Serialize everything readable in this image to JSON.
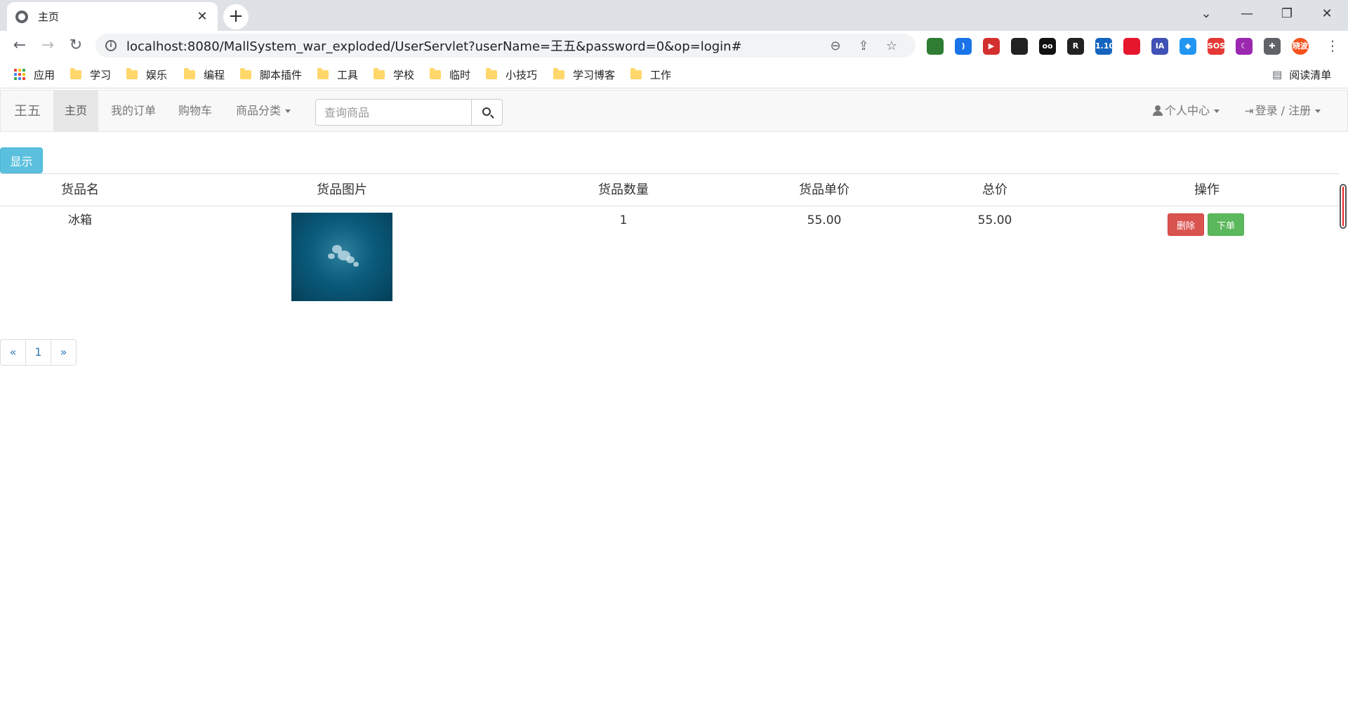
{
  "browser": {
    "tab_title": "主页",
    "tab_close": "✕",
    "new_tab": "+",
    "url": "localhost:8080/MallSystem_war_exploded/UserServlet?userName=王五&password=0&op=login#",
    "extensions": [
      {
        "icon": "ext-green-circle",
        "color": "#2e7d32",
        "text": ""
      },
      {
        "icon": "ext-wifi",
        "color": "#1a73e8",
        "text": ")"
      },
      {
        "icon": "ext-red-play",
        "color": "#d32f2f",
        "text": "▶"
      },
      {
        "icon": "ext-dark-glasses",
        "color": "#222222",
        "text": ""
      },
      {
        "icon": "ext-owl",
        "color": "#111111",
        "text": "oo"
      },
      {
        "icon": "ext-r",
        "color": "#222222",
        "text": "R"
      },
      {
        "icon": "ext-flag",
        "color": "#1565c0",
        "text": "1.10"
      },
      {
        "icon": "ext-weibo",
        "color": "#e6162d",
        "text": ""
      },
      {
        "icon": "ext-ia",
        "color": "#3f51b5",
        "text": "IA"
      },
      {
        "icon": "ext-diamond",
        "color": "#2196f3",
        "text": "◆"
      },
      {
        "icon": "ext-sos",
        "color": "#e53935",
        "text": "SOS"
      },
      {
        "icon": "ext-moon",
        "color": "#9c27b0",
        "text": "☾"
      },
      {
        "icon": "ext-puzzle",
        "color": "#5f6368",
        "text": "✚"
      },
      {
        "icon": "ext-avatar",
        "color": "#f4511e",
        "text": "晓波"
      }
    ],
    "bookmarks": {
      "apps": "应用",
      "folders": [
        "学习",
        "娱乐",
        "编程",
        "脚本插件",
        "工具",
        "学校",
        "临时",
        "小技巧",
        "学习博客",
        "工作"
      ],
      "reading_list": "阅读清单"
    }
  },
  "navbar": {
    "brand": "王五",
    "home": "主页",
    "orders": "我的订单",
    "cart": "购物车",
    "categories": "商品分类",
    "search_placeholder": "查询商品",
    "personal_center": "个人中心",
    "login_register": "登录 / 注册"
  },
  "content": {
    "show_button": "显示",
    "table": {
      "headers": [
        "货品名",
        "货品图片",
        "货品数量",
        "货品单价",
        "总价",
        "操作"
      ],
      "rows": [
        {
          "name": "冰箱",
          "quantity": "1",
          "unit_price": "55.00",
          "total": "55.00",
          "delete_label": "删除",
          "order_label": "下单"
        }
      ]
    },
    "pagination": {
      "prev": "«",
      "page": "1",
      "next": "»"
    }
  },
  "colors": {
    "info": "#5bc0de",
    "danger": "#d9534f",
    "success": "#5cb85c",
    "link": "#337ab7",
    "navbar_bg": "#f8f8f8"
  }
}
